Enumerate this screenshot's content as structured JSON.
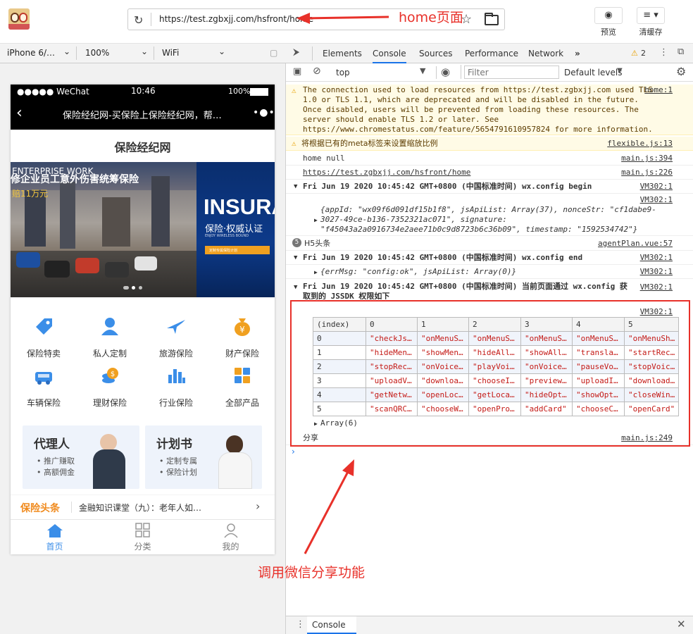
{
  "toolbar": {
    "url": "https://test.zgbxjj.com/hsfront/home",
    "preview_label": "预览",
    "clear_cache_label": "清缓存"
  },
  "annotations": {
    "home_label": "home页面",
    "share_label": "调用微信分享功能",
    "color": "#e8312a"
  },
  "device_bar": {
    "device": "iPhone 6/…",
    "zoom": "100%",
    "network": "WiFi"
  },
  "phone": {
    "status": {
      "carrier": "●●●●● WeChat",
      "time": "10:46",
      "battery": "100%"
    },
    "nav_title": "保险经纪网-买保险上保险经纪网，帮…",
    "brand": "保险经纪网",
    "banner": {
      "left_text": "修企业员工意外伤害统筹保险",
      "left_sub": "赔11万元",
      "left_small": "ENTERPRISE WORK",
      "right_big": "INSURA",
      "right_sub": "保险·权威认证",
      "right_small": "ENJOY WIRELESS BOUND",
      "right_btn": "定制专属保险计划"
    },
    "grid": [
      {
        "label": "保险特卖",
        "icon": "tag-icon",
        "color": "#3b8ee8"
      },
      {
        "label": "私人定制",
        "icon": "person-icon",
        "color": "#3b8ee8"
      },
      {
        "label": "旅游保险",
        "icon": "plane-icon",
        "color": "#3b8ee8"
      },
      {
        "label": "财产保险",
        "icon": "money-bag-icon",
        "color": "#f0a020"
      },
      {
        "label": "车辆保险",
        "icon": "car-icon",
        "color": "#3b8ee8"
      },
      {
        "label": "理财保险",
        "icon": "coins-icon",
        "color": "#f0a020"
      },
      {
        "label": "行业保险",
        "icon": "bar-chart-icon",
        "color": "#3b8ee8"
      },
      {
        "label": "全部产品",
        "icon": "apps-icon",
        "color": "#f0a020"
      }
    ],
    "cards": [
      {
        "title": "代理人",
        "items": [
          "推广赚取",
          "高额佣金"
        ]
      },
      {
        "title": "计划书",
        "items": [
          "定制专属",
          "保险计划"
        ]
      }
    ],
    "news": {
      "tag": "保险头条",
      "text": "金融知识课堂（九）：老年人如…"
    },
    "tabs": [
      "首页",
      "分类",
      "我的"
    ]
  },
  "devtools": {
    "tabs": [
      "Elements",
      "Console",
      "Sources",
      "Performance",
      "Network"
    ],
    "warn_count": "2",
    "context": "top",
    "filter_placeholder": "Filter",
    "levels": "Default levels",
    "drawer_tab": "Console",
    "logs": {
      "tls_msg": "The connection used to load resources from https://test.zgbxjj.com used TLS 1.0 or TLS 1.1, which are deprecated and will be disabled in the future. Once disabled, users will be prevented from loading these resources. The server should enable TLS 1.2 or later. See https://www.chromestatus.com/feature/5654791610957824 for more information.",
      "tls_src": "home:1",
      "meta_msg": "将根据已有的meta标签来设置缩放比例",
      "meta_src": "flexible.js:13",
      "home_null": "home null",
      "home_null_src": "main.js:394",
      "home_url": "https://test.zgbxjj.com/hsfront/home",
      "home_url_src": "main.js:226",
      "group1": "Fri Jun 19 2020 10:45:42 GMT+0800 (中国标准时间) wx.config begin",
      "group1_src": "VM302:1",
      "config_obj": "{appId: \"wx09f6d091df15b1f8\", jsApiList: Array(37), nonceStr: \"cf1dabe9-3027-49ce-b136-7352321ac071\", signature: \"f45043a2a0916734e2aee71b0c9d8723b6c36b09\", timestamp: \"1592534742\"}",
      "config_src": "VM302:1",
      "h5_count": "5",
      "h5_msg": "H5头条",
      "h5_src": "agentPlan.vue:57",
      "group2": "Fri Jun 19 2020 10:45:42 GMT+0800 (中国标准时间) wx.config end",
      "group2_src": "VM302:1",
      "errmsg": "{errMsg: \"config:ok\", jsApiList: Array(0)}",
      "errmsg_src": "VM302:1",
      "group3": "Fri Jun 19 2020 10:45:42 GMT+0800 (中国标准时间) 当前页面通过 wx.config 获取到的 JSSDK 权限如下",
      "group3_src": "VM302:1",
      "table_src": "VM302:1",
      "array_summary": "Array(6)",
      "share": "分享",
      "share_src": "main.js:249"
    },
    "table": {
      "headers": [
        "(index)",
        "0",
        "1",
        "2",
        "3",
        "4",
        "5"
      ],
      "rows": [
        [
          "0",
          "\"checkJs…",
          "\"onMenuS…",
          "\"onMenuS…",
          "\"onMenuS…",
          "\"onMenuS…",
          "\"onMenuSh…"
        ],
        [
          "1",
          "\"hideMen…",
          "\"showMen…",
          "\"hideAll…",
          "\"showAll…",
          "\"transla…",
          "\"startRec…"
        ],
        [
          "2",
          "\"stopRec…",
          "\"onVoice…",
          "\"playVoi…",
          "\"onVoice…",
          "\"pauseVo…",
          "\"stopVoic…"
        ],
        [
          "3",
          "\"uploadV…",
          "\"downloa…",
          "\"chooseI…",
          "\"preview…",
          "\"uploadI…",
          "\"download…"
        ],
        [
          "4",
          "\"getNetw…",
          "\"openLoc…",
          "\"getLoca…",
          "\"hideOpt…",
          "\"showOpt…",
          "\"closeWin…"
        ],
        [
          "5",
          "\"scanQRC…",
          "\"chooseW…",
          "\"openPro…",
          "\"addCard\"",
          "\"chooseC…",
          "\"openCard\""
        ]
      ]
    }
  }
}
